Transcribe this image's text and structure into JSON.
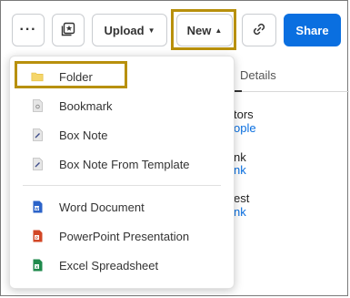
{
  "toolbar": {
    "more_label": "···",
    "upload_label": "Upload",
    "new_label": "New",
    "share_label": "Share"
  },
  "background": {
    "details_tab": "Details",
    "fragments": [
      {
        "text": "tors",
        "link": "ople"
      },
      {
        "text": "nk",
        "link": "nk"
      },
      {
        "text": "est",
        "link": "nk"
      }
    ]
  },
  "menu": {
    "items": [
      {
        "label": "Folder",
        "icon": "folder-icon",
        "color": "#f5d66b"
      },
      {
        "label": "Bookmark",
        "icon": "bookmark-icon",
        "color": "#c7c7c7"
      },
      {
        "label": "Box Note",
        "icon": "box-note-icon",
        "color": "#c7c7c7"
      },
      {
        "label": "Box Note From Template",
        "icon": "box-note-template-icon",
        "color": "#c7c7c7"
      },
      {
        "label": "Word Document",
        "icon": "word-doc-icon",
        "color": "#2b63c9"
      },
      {
        "label": "PowerPoint Presentation",
        "icon": "powerpoint-icon",
        "color": "#d24726"
      },
      {
        "label": "Excel Spreadsheet",
        "icon": "excel-icon",
        "color": "#1f8a4c"
      }
    ]
  },
  "colors": {
    "accent": "#0a6fe0",
    "highlight": "#b8900c"
  }
}
